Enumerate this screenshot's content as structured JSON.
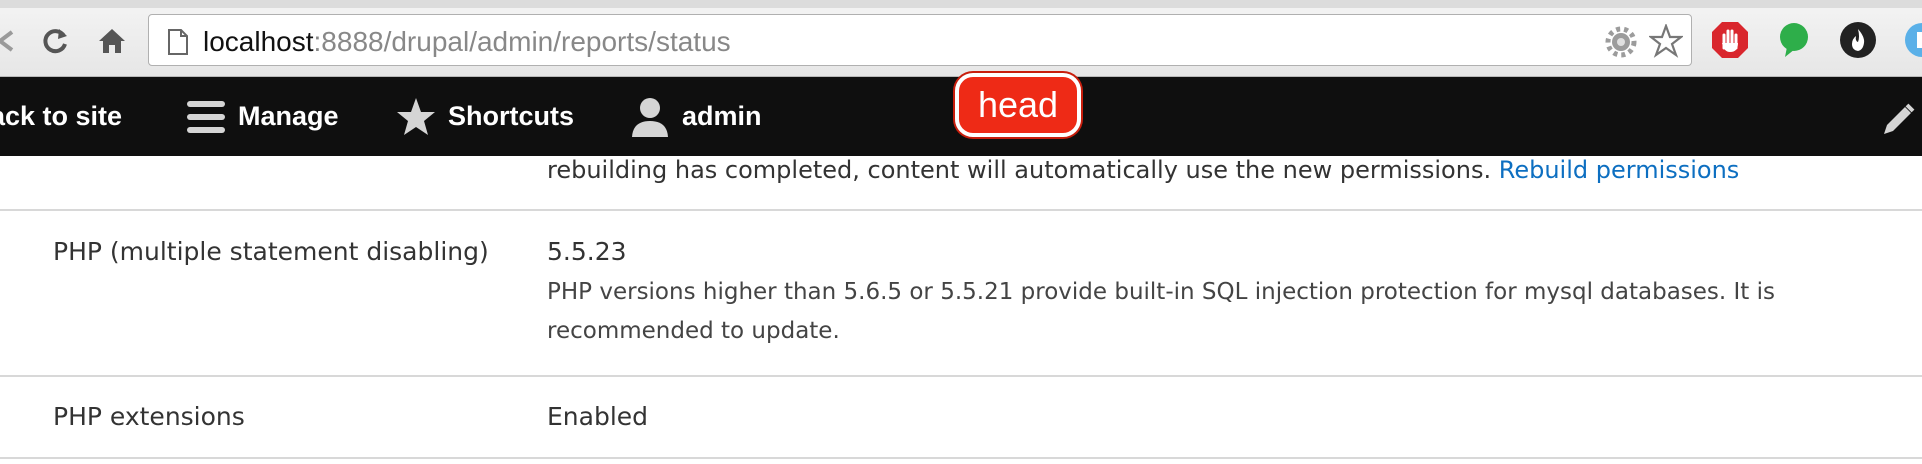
{
  "browser": {
    "url_host": "localhost",
    "url_rest": ":8888/drupal/admin/reports/status",
    "icons": [
      "back-icon",
      "reload-icon",
      "home-icon",
      "page-icon",
      "settings-gear-icon",
      "bookmark-star-icon",
      "adblock-icon",
      "chat-icon",
      "fire-icon",
      "extension-icon"
    ]
  },
  "toolbar": {
    "back_to_site": "ack to site",
    "manage": "Manage",
    "shortcuts": "Shortcuts",
    "admin": "admin"
  },
  "annotation": {
    "label": "head",
    "color": "#ee2a16"
  },
  "status": {
    "prev_desc_text": "rebuilding has completed, content will automatically use the new permissions.",
    "prev_desc_link": "Rebuild permissions",
    "rows": [
      {
        "label": "PHP (multiple statement disabling)",
        "value": "5.5.23",
        "detail": "PHP versions higher than 5.6.5 or 5.5.21 provide built-in SQL injection protection for mysql databases. It is recommended to update."
      },
      {
        "label": "PHP extensions",
        "value": "Enabled"
      }
    ]
  },
  "colors": {
    "toolbar_bg": "#0f0f0f",
    "link": "#0d6fc1",
    "row_border": "#d8d8d8"
  }
}
